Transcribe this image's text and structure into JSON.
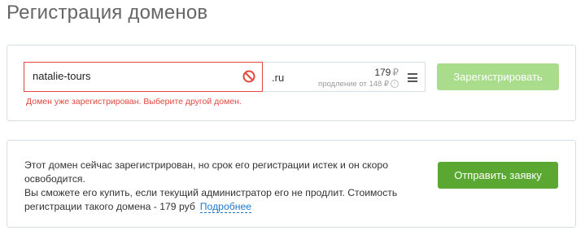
{
  "page": {
    "title": "Регистрация доменов"
  },
  "search": {
    "domain_value": "natalie-tours",
    "error_message": "Домен уже зарегистрирован. Выберите другой домен.",
    "zone": ".ru",
    "price": "179",
    "currency": "₽",
    "renewal": "продление от 148 ₽",
    "register_label": "Зарегистрировать"
  },
  "notice": {
    "line1": "Этот домен сейчас зарегистрирован, но срок его регистрации истек и он скоро освободится.",
    "line2": "Вы сможете его купить, если текущий администратор его не продлит. Стоимость регистрации такого домена - 179 руб",
    "more_link": "Подробнее",
    "request_label": "Отправить заявку"
  },
  "colors": {
    "error": "#e2483d",
    "accent_green": "#5aa832",
    "disabled_green": "#a9dc8b",
    "link": "#1f77c9"
  }
}
